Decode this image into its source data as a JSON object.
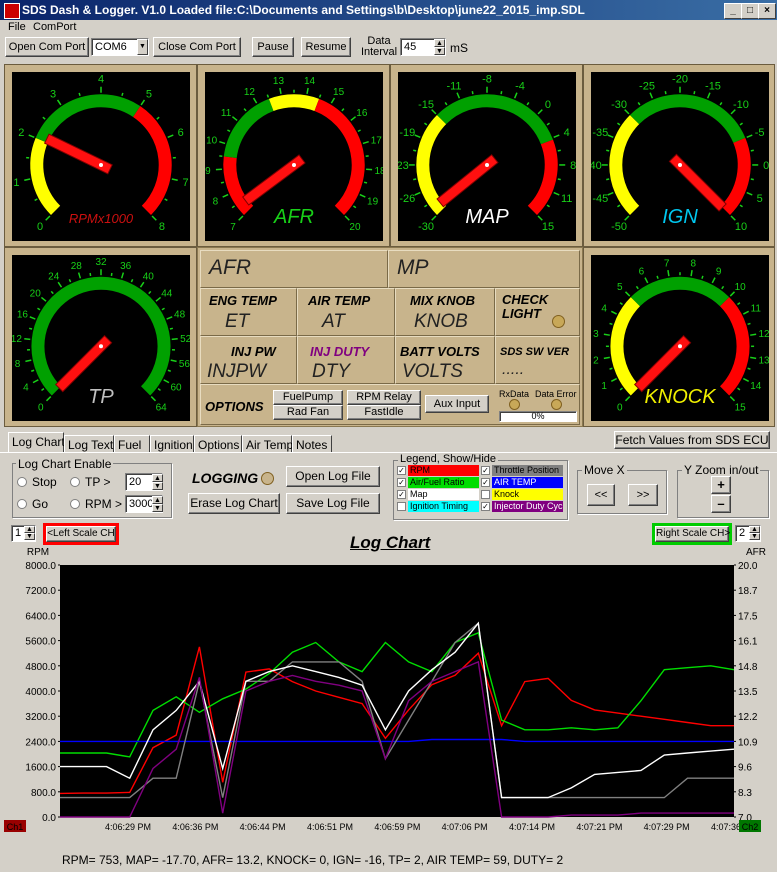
{
  "window": {
    "title": "SDS Dash & Logger. V1.0 Loaded file:C:\\Documents and Settings\\b\\Desktop\\june22_2015_imp.SDL",
    "min": "_",
    "max": "□",
    "close": "×"
  },
  "menu": {
    "file": "File",
    "comport": "ComPort"
  },
  "toolbar": {
    "open_com": "Open Com Port",
    "com_value": "COM6",
    "close_com": "Close Com Port",
    "pause": "Pause",
    "resume": "Resume",
    "interval_label": "Data Interval",
    "interval_value": "45",
    "interval_unit": "mS"
  },
  "gauges": {
    "rpm": {
      "label": "RPMx1000",
      "ticks": [
        "0",
        "1",
        "2",
        "3",
        "4",
        "5",
        "6",
        "7",
        "8"
      ],
      "label_color": "#cc1010",
      "needle_value": 2.1
    },
    "afr": {
      "label": "AFR",
      "ticks": [
        "7",
        "8",
        "9",
        "10",
        "11",
        "12",
        "13",
        "14",
        "15",
        "16",
        "17",
        "18",
        "19",
        "20"
      ],
      "label_color": "#18d018",
      "needle_value": 7.4
    },
    "map": {
      "label": "MAP",
      "ticks": [
        "-30",
        "-26",
        "-23",
        "-19",
        "-15",
        "-11",
        "-8",
        "-4",
        "0",
        "4",
        "8",
        "11",
        "15"
      ],
      "label_color": "#ffffff",
      "needle_value": -29
    },
    "ign": {
      "label": "IGN",
      "ticks": [
        "-50",
        "-45",
        "-40",
        "-35",
        "-30",
        "-25",
        "-20",
        "-15",
        "-10",
        "-5",
        "0",
        "5",
        "10"
      ],
      "label_color": "#00c8f0",
      "needle_value": 10
    },
    "tp": {
      "label": "TP",
      "ticks": [
        "0",
        "4",
        "8",
        "12",
        "16",
        "20",
        "24",
        "28",
        "32",
        "36",
        "40",
        "44",
        "48",
        "52",
        "56",
        "60",
        "64"
      ],
      "label_color": "#c0c0c0",
      "needle_value": 0
    },
    "knock": {
      "label": "KNOCK",
      "ticks": [
        "0",
        "1",
        "2",
        "3",
        "4",
        "5",
        "6",
        "7",
        "8",
        "9",
        "10",
        "11",
        "12",
        "13",
        "14",
        "15"
      ],
      "label_color": "#f0f000",
      "needle_value": 0
    }
  },
  "center": {
    "afr": "AFR",
    "mp": "MP",
    "eng_temp": "ENG TEMP",
    "et": "ET",
    "air_temp": "AIR TEMP",
    "at": "AT",
    "mix_knob": "MIX KNOB",
    "knob": "KNOB",
    "check_light": "CHECK LIGHT",
    "inj_pw": "INJ PW",
    "injpw": "INJPW",
    "inj_duty": "INJ DUTY",
    "dty": "DTY",
    "batt_volts": "BATT VOLTS",
    "volts": "VOLTS",
    "sds_sw_ver": "SDS SW  VER",
    "ver_val": ".....",
    "options": "OPTIONS",
    "fuelpump": "FuelPump",
    "rpm_relay": "RPM Relay",
    "rad_fan": "Rad Fan",
    "fastidle": "FastIdle",
    "aux_input": "Aux Input",
    "rxdata": "RxData",
    "data_error": "Data Error",
    "progress": "0%"
  },
  "tabs": [
    "Log Chart",
    "Log Text",
    "Fuel",
    "Ignition",
    "Options",
    "Air Temp",
    "Notes"
  ],
  "fetch_button": "Fetch Values from SDS ECU",
  "log_enable": {
    "title": "Log Chart Enable",
    "stop": "Stop",
    "go": "Go",
    "tp": "TP >",
    "tp_value": "20",
    "rpm": "RPM >",
    "rpm_value": "3000"
  },
  "logging": {
    "label": "LOGGING",
    "open": "Open Log File",
    "erase": "Erase Log Chart",
    "save": "Save Log File"
  },
  "legend": {
    "title": "Legend, Show/Hide",
    "items": [
      {
        "label": "RPM",
        "color": "#ff0000",
        "text_color": "#000000"
      },
      {
        "label": "Throttle Position",
        "color": "#808080",
        "text_color": "#000000"
      },
      {
        "label": "Air/Fuel Ratio",
        "color": "#00dd00",
        "text_color": "#000000"
      },
      {
        "label": "AIR TEMP",
        "color": "#0000ff",
        "text_color": "#ffffff"
      },
      {
        "label": "Map",
        "color": "#ffffff",
        "text_color": "#000000"
      },
      {
        "label": "Knock",
        "color": "#ffff00",
        "text_color": "#000000"
      },
      {
        "label": "Ignition Timing",
        "color": "#00ffff",
        "text_color": "#000000"
      },
      {
        "label": "Injector Duty Cyc",
        "color": "#800080",
        "text_color": "#ffffff"
      }
    ]
  },
  "move": {
    "title": "Move X",
    "left": "<<",
    "right": ">>"
  },
  "zoom": {
    "title": "Y Zoom in/out",
    "plus": "+",
    "minus": "–"
  },
  "chart": {
    "left_ch": "1",
    "left_scale": "<Left Scale CH",
    "right_scale": "Right Scale CH>",
    "right_ch": "2",
    "title": "Log Chart",
    "ch1": "Ch1",
    "ch2": "Ch2"
  },
  "chart_data": {
    "type": "line",
    "title": "Log Chart",
    "ylabel_left": "RPM",
    "ylabel_right": "AFR",
    "y_left_ticks": [
      "8000.0",
      "7200.0",
      "6400.0",
      "5600.0",
      "4800.0",
      "4000.0",
      "3200.0",
      "2400.0",
      "1600.0",
      "800.0",
      "0.0"
    ],
    "y_right_ticks": [
      "20.0",
      "18.7",
      "17.5",
      "16.1",
      "14.8",
      "13.5",
      "12.2",
      "10.9",
      "9.6",
      "8.3",
      "7.0"
    ],
    "x_ticks": [
      "4:06:29 PM",
      "4:06:36 PM",
      "4:06:44 PM",
      "4:06:51 PM",
      "4:06:59 PM",
      "4:07:06 PM",
      "4:07:14 PM",
      "4:07:21 PM",
      "4:07:29 PM",
      "4:07:36 PM"
    ],
    "ylim_left": [
      0,
      8000
    ],
    "ylim_right": [
      7,
      20
    ],
    "grid": false,
    "series": [
      {
        "name": "RPM",
        "color": "#ff0000",
        "values": [
          750,
          760,
          760,
          780,
          2200,
          2600,
          5400,
          1100,
          4600,
          4700,
          4300,
          4000,
          3800,
          3600,
          2500,
          3400,
          4200,
          4500,
          5200,
          2900,
          4300,
          4400,
          3700,
          3400,
          3300,
          3200,
          3100,
          3000,
          2900,
          2900
        ]
      },
      {
        "name": "Air/Fuel Ratio",
        "color": "#00dd00",
        "values": [
          10.3,
          10.3,
          10.3,
          10.1,
          12.5,
          13.2,
          12.4,
          13.1,
          13.6,
          14.4,
          15.5,
          16.0,
          15.0,
          14.5,
          16.0,
          15.0,
          14.5,
          16.0,
          16.5,
          12.0,
          11.5,
          11.5,
          11.6,
          11.5,
          11.6,
          13.0,
          14.6,
          14.7,
          14.8,
          14.6
        ]
      },
      {
        "name": "AIR TEMP",
        "color": "#0000ff",
        "values": [
          10.9,
          10.9,
          10.9,
          10.9,
          10.9,
          10.9,
          10.9,
          10.9,
          10.9,
          10.9,
          10.9,
          10.9,
          10.9,
          10.9,
          10.9,
          10.9,
          11.0,
          11.0,
          11.0,
          11.0,
          10.9,
          10.9,
          10.9,
          10.9,
          10.9,
          10.9,
          10.9,
          10.9,
          10.9,
          10.9
        ]
      },
      {
        "name": "Throttle Position",
        "color": "#808080",
        "values": [
          8,
          8,
          8,
          8,
          9,
          9,
          14,
          8,
          14,
          14,
          15,
          15,
          15,
          14,
          10,
          12,
          14,
          16,
          17,
          8,
          8,
          8,
          8,
          8,
          8,
          8,
          8,
          9,
          9,
          9
        ]
      },
      {
        "name": "Map",
        "color": "#ffffff",
        "values": [
          9.6,
          9.6,
          9.6,
          9.0,
          11.5,
          12.5,
          14.0,
          9.5,
          14.0,
          14.5,
          14.8,
          14.5,
          14.2,
          13.8,
          11.5,
          13.5,
          14.6,
          15.5,
          17.0,
          8.0,
          8.0,
          8.0,
          8.5,
          9.2,
          9.3,
          9.4,
          10.2,
          10.3,
          10.4,
          10.5
        ]
      },
      {
        "name": "Injector Duty Cyc",
        "color": "#800080",
        "values": [
          7.0,
          7.0,
          7.0,
          7.0,
          9.5,
          10.5,
          14.2,
          7.2,
          13.5,
          14.0,
          14.3,
          14.0,
          13.8,
          13.5,
          10.0,
          13.0,
          14.0,
          14.5,
          15.0,
          7.0,
          7.0,
          7.0,
          7.1,
          7.1,
          7.1,
          7.2,
          7.2,
          7.2,
          7.2,
          7.2
        ]
      }
    ]
  },
  "status": "RPM= 753, MAP= -17.70, AFR= 13.2, KNOCK= 0, IGN= -16, TP= 2, AIR TEMP= 59, DUTY= 2"
}
